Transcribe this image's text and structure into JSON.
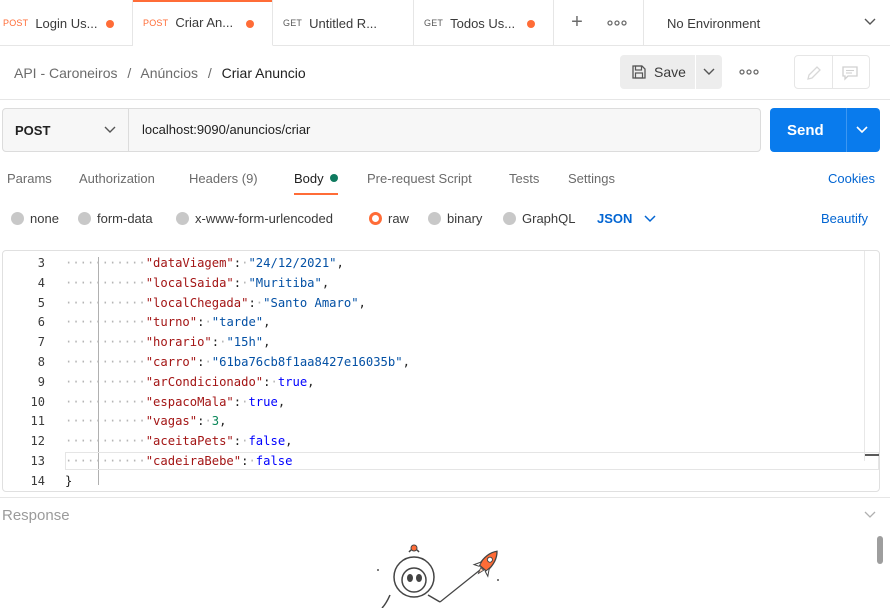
{
  "tabs": [
    {
      "method": "POST",
      "name": "Login Us...",
      "unsaved": true
    },
    {
      "method": "POST",
      "name": "Criar An...",
      "unsaved": true,
      "active": true
    },
    {
      "method": "GET",
      "name": "Untitled R...",
      "unsaved": false
    },
    {
      "method": "GET",
      "name": "Todos Us...",
      "unsaved": true
    }
  ],
  "environment": {
    "label": "No Environment"
  },
  "breadcrumb": {
    "collection": "API - Caroneiros",
    "folder": "Anúncios",
    "request": "Criar Anuncio",
    "separator": "/"
  },
  "toolbar": {
    "save_label": "Save"
  },
  "request": {
    "method": "POST",
    "url": "localhost:9090/anuncios/criar",
    "send_label": "Send"
  },
  "request_tabs": {
    "params": "Params",
    "authorization": "Authorization",
    "headers": "Headers (9)",
    "body": "Body",
    "prerequest": "Pre-request Script",
    "tests": "Tests",
    "settings": "Settings",
    "cookies": "Cookies"
  },
  "body_types": {
    "none": "none",
    "form_data": "form-data",
    "urlencoded": "x-www-form-urlencoded",
    "raw": "raw",
    "binary": "binary",
    "graphql": "GraphQL",
    "format": "JSON",
    "beautify": "Beautify",
    "selected": "raw"
  },
  "editor": {
    "lines": [
      {
        "n": "3",
        "key": "\"dataViagem\"",
        "value": "\"24/12/2021\"",
        "vtype": "str",
        "comma": true
      },
      {
        "n": "4",
        "key": "\"localSaida\"",
        "value": "\"Muritiba\"",
        "vtype": "str",
        "comma": true
      },
      {
        "n": "5",
        "key": "\"localChegada\"",
        "value": "\"Santo Amaro\"",
        "vtype": "str",
        "comma": true
      },
      {
        "n": "6",
        "key": "\"turno\"",
        "value": "\"tarde\"",
        "vtype": "str",
        "comma": true
      },
      {
        "n": "7",
        "key": "\"horario\"",
        "value": "\"15h\"",
        "vtype": "str",
        "comma": true
      },
      {
        "n": "8",
        "key": "\"carro\"",
        "value": "\"61ba76cb8f1aa8427e16035b\"",
        "vtype": "str",
        "comma": true
      },
      {
        "n": "9",
        "key": "\"arCondicionado\"",
        "value": "true",
        "vtype": "kw",
        "comma": true
      },
      {
        "n": "10",
        "key": "\"espacoMala\"",
        "value": "true",
        "vtype": "kw",
        "comma": true
      },
      {
        "n": "11",
        "key": "\"vagas\"",
        "value": "3",
        "vtype": "num",
        "comma": true
      },
      {
        "n": "12",
        "key": "\"aceitaPets\"",
        "value": "false",
        "vtype": "kw",
        "comma": true
      },
      {
        "n": "13",
        "key": "\"cadeiraBebe\"",
        "value": "false",
        "vtype": "kw",
        "comma": false
      },
      {
        "n": "14",
        "brace": "}"
      }
    ]
  },
  "response": {
    "label": "Response"
  },
  "colors": {
    "accent": "#ff6c37",
    "primary": "#097bed",
    "link": "#0265d2",
    "body_dot": "#0f7a5f"
  }
}
